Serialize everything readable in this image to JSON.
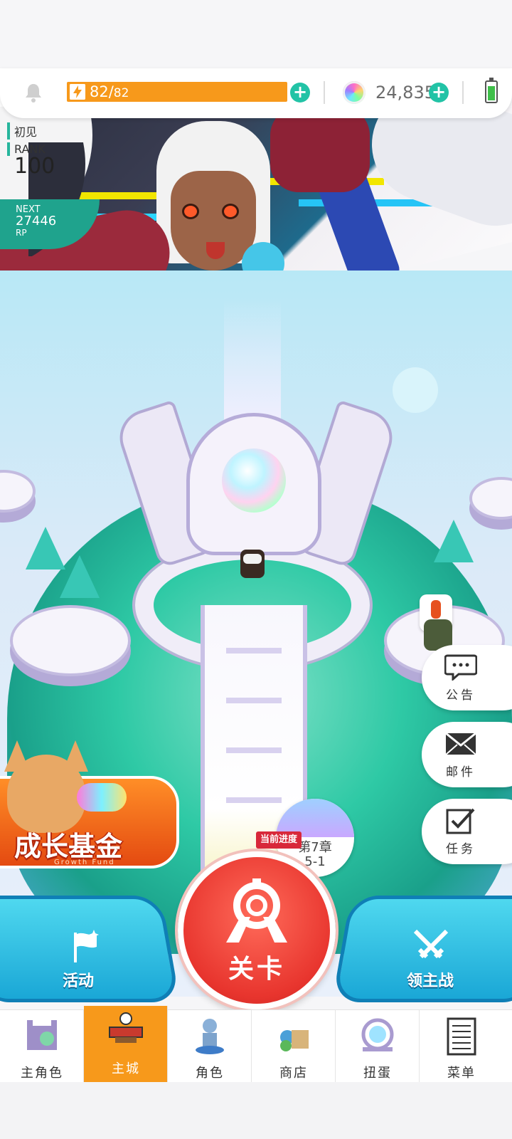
{
  "resources": {
    "stamina_current": "82/",
    "stamina_max": "82",
    "stamina_level": 1.0,
    "gem_count": "24,835"
  },
  "rank": {
    "greeting": "初见",
    "label": "RANK",
    "value": "100",
    "next_label": "NEXT",
    "next_value": "27446",
    "next_unit": "RP"
  },
  "side_buttons": {
    "announcement": "公告",
    "mail": "邮件",
    "quest": "任务"
  },
  "promo": {
    "title": "成长基金",
    "subtitle": "Growth Fund"
  },
  "chapter": {
    "tag": "当前进度",
    "line1": "第7章",
    "line2": "5-1"
  },
  "actions": {
    "event": "活动",
    "stage": "关卡",
    "lord_battle": "领主战"
  },
  "tabs": [
    {
      "label": "主角色"
    },
    {
      "label": "主城"
    },
    {
      "label": "角色"
    },
    {
      "label": "商店"
    },
    {
      "label": "扭蛋"
    },
    {
      "label": "菜单"
    }
  ],
  "colors": {
    "accent_orange": "#f7991b",
    "accent_teal": "#22c3a6",
    "stage_red": "#e8352e",
    "action_blue": "#1aa7d6"
  }
}
